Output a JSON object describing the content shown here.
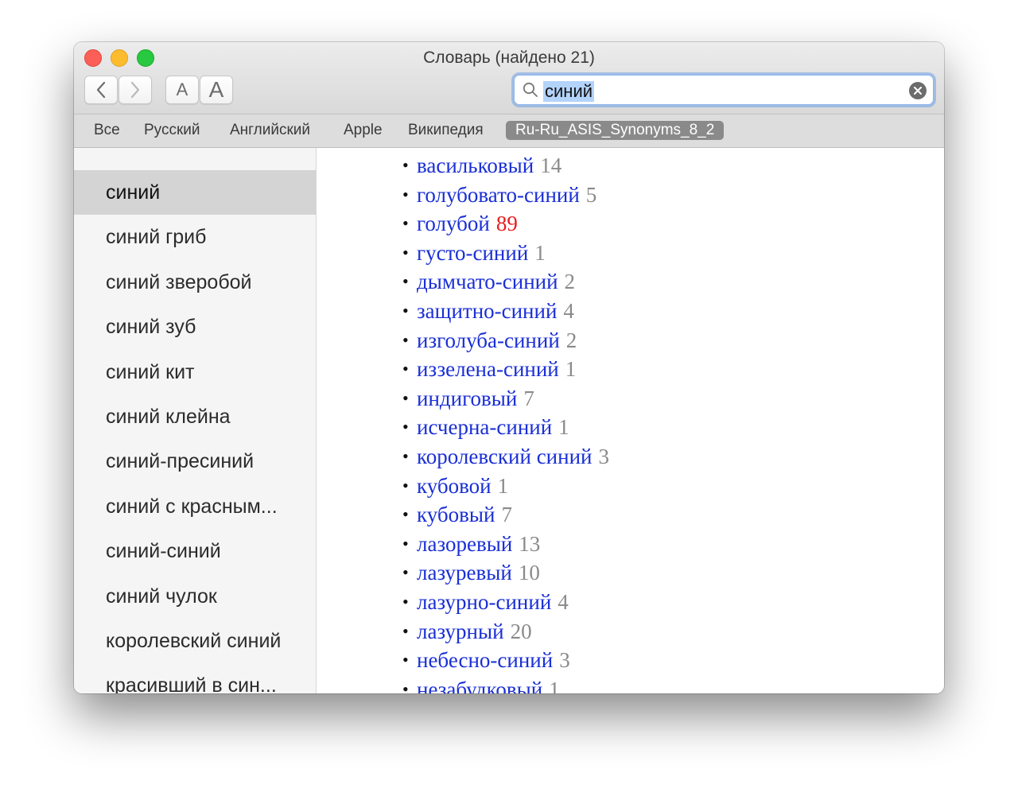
{
  "window": {
    "title": "Словарь (найдено 21)"
  },
  "toolbar": {
    "back_label": "back",
    "forward_label": "forward",
    "font_small": "A",
    "font_large": "A"
  },
  "search": {
    "value": "синий",
    "placeholder": ""
  },
  "scopes": [
    {
      "label": "Все",
      "active": false
    },
    {
      "label": "Русский",
      "active": false
    },
    {
      "label": "Английский",
      "active": false
    },
    {
      "label": "Apple",
      "active": false
    },
    {
      "label": "Википедия",
      "active": false
    },
    {
      "label": "Ru-Ru_ASIS_Synonyms_8_2",
      "active": true
    }
  ],
  "sidebar": {
    "items": [
      {
        "label": "синий",
        "selected": true
      },
      {
        "label": "синий гриб",
        "selected": false
      },
      {
        "label": "синий зверобой",
        "selected": false
      },
      {
        "label": "синий зуб",
        "selected": false
      },
      {
        "label": "синий кит",
        "selected": false
      },
      {
        "label": "синий клейна",
        "selected": false
      },
      {
        "label": "синий-пресиний",
        "selected": false
      },
      {
        "label": "синий с красным...",
        "selected": false
      },
      {
        "label": "синий-синий",
        "selected": false
      },
      {
        "label": "синий чулок",
        "selected": false
      },
      {
        "label": "королевский синий",
        "selected": false
      },
      {
        "label": "красивший в син...",
        "selected": false
      }
    ]
  },
  "synonyms": [
    {
      "word": "васильковый",
      "count": "14",
      "hot": false
    },
    {
      "word": "голубовато-синий",
      "count": "5",
      "hot": false
    },
    {
      "word": "голубой",
      "count": "89",
      "hot": true
    },
    {
      "word": "густо-синий",
      "count": "1",
      "hot": false
    },
    {
      "word": "дымчато-синий",
      "count": "2",
      "hot": false
    },
    {
      "word": "защитно-синий",
      "count": "4",
      "hot": false
    },
    {
      "word": "изголуба-синий",
      "count": "2",
      "hot": false
    },
    {
      "word": "иззелена-синий",
      "count": "1",
      "hot": false
    },
    {
      "word": "индиговый",
      "count": "7",
      "hot": false
    },
    {
      "word": "исчерна-синий",
      "count": "1",
      "hot": false
    },
    {
      "word": "королевский синий",
      "count": "3",
      "hot": false
    },
    {
      "word": "кубовой",
      "count": "1",
      "hot": false
    },
    {
      "word": "кубовый",
      "count": "7",
      "hot": false
    },
    {
      "word": "лазоревый",
      "count": "13",
      "hot": false
    },
    {
      "word": "лазуревый",
      "count": "10",
      "hot": false
    },
    {
      "word": "лазурно-синий",
      "count": "4",
      "hot": false
    },
    {
      "word": "лазурный",
      "count": "20",
      "hot": false
    },
    {
      "word": "небесно-синий",
      "count": "3",
      "hot": false
    },
    {
      "word": "незабудковый",
      "count": "1",
      "hot": false
    }
  ],
  "colors": {
    "link": "#1a2fd6",
    "count": "#8a8a8a",
    "count_hot": "#e81d1d",
    "selection": "#b3d3fb"
  }
}
